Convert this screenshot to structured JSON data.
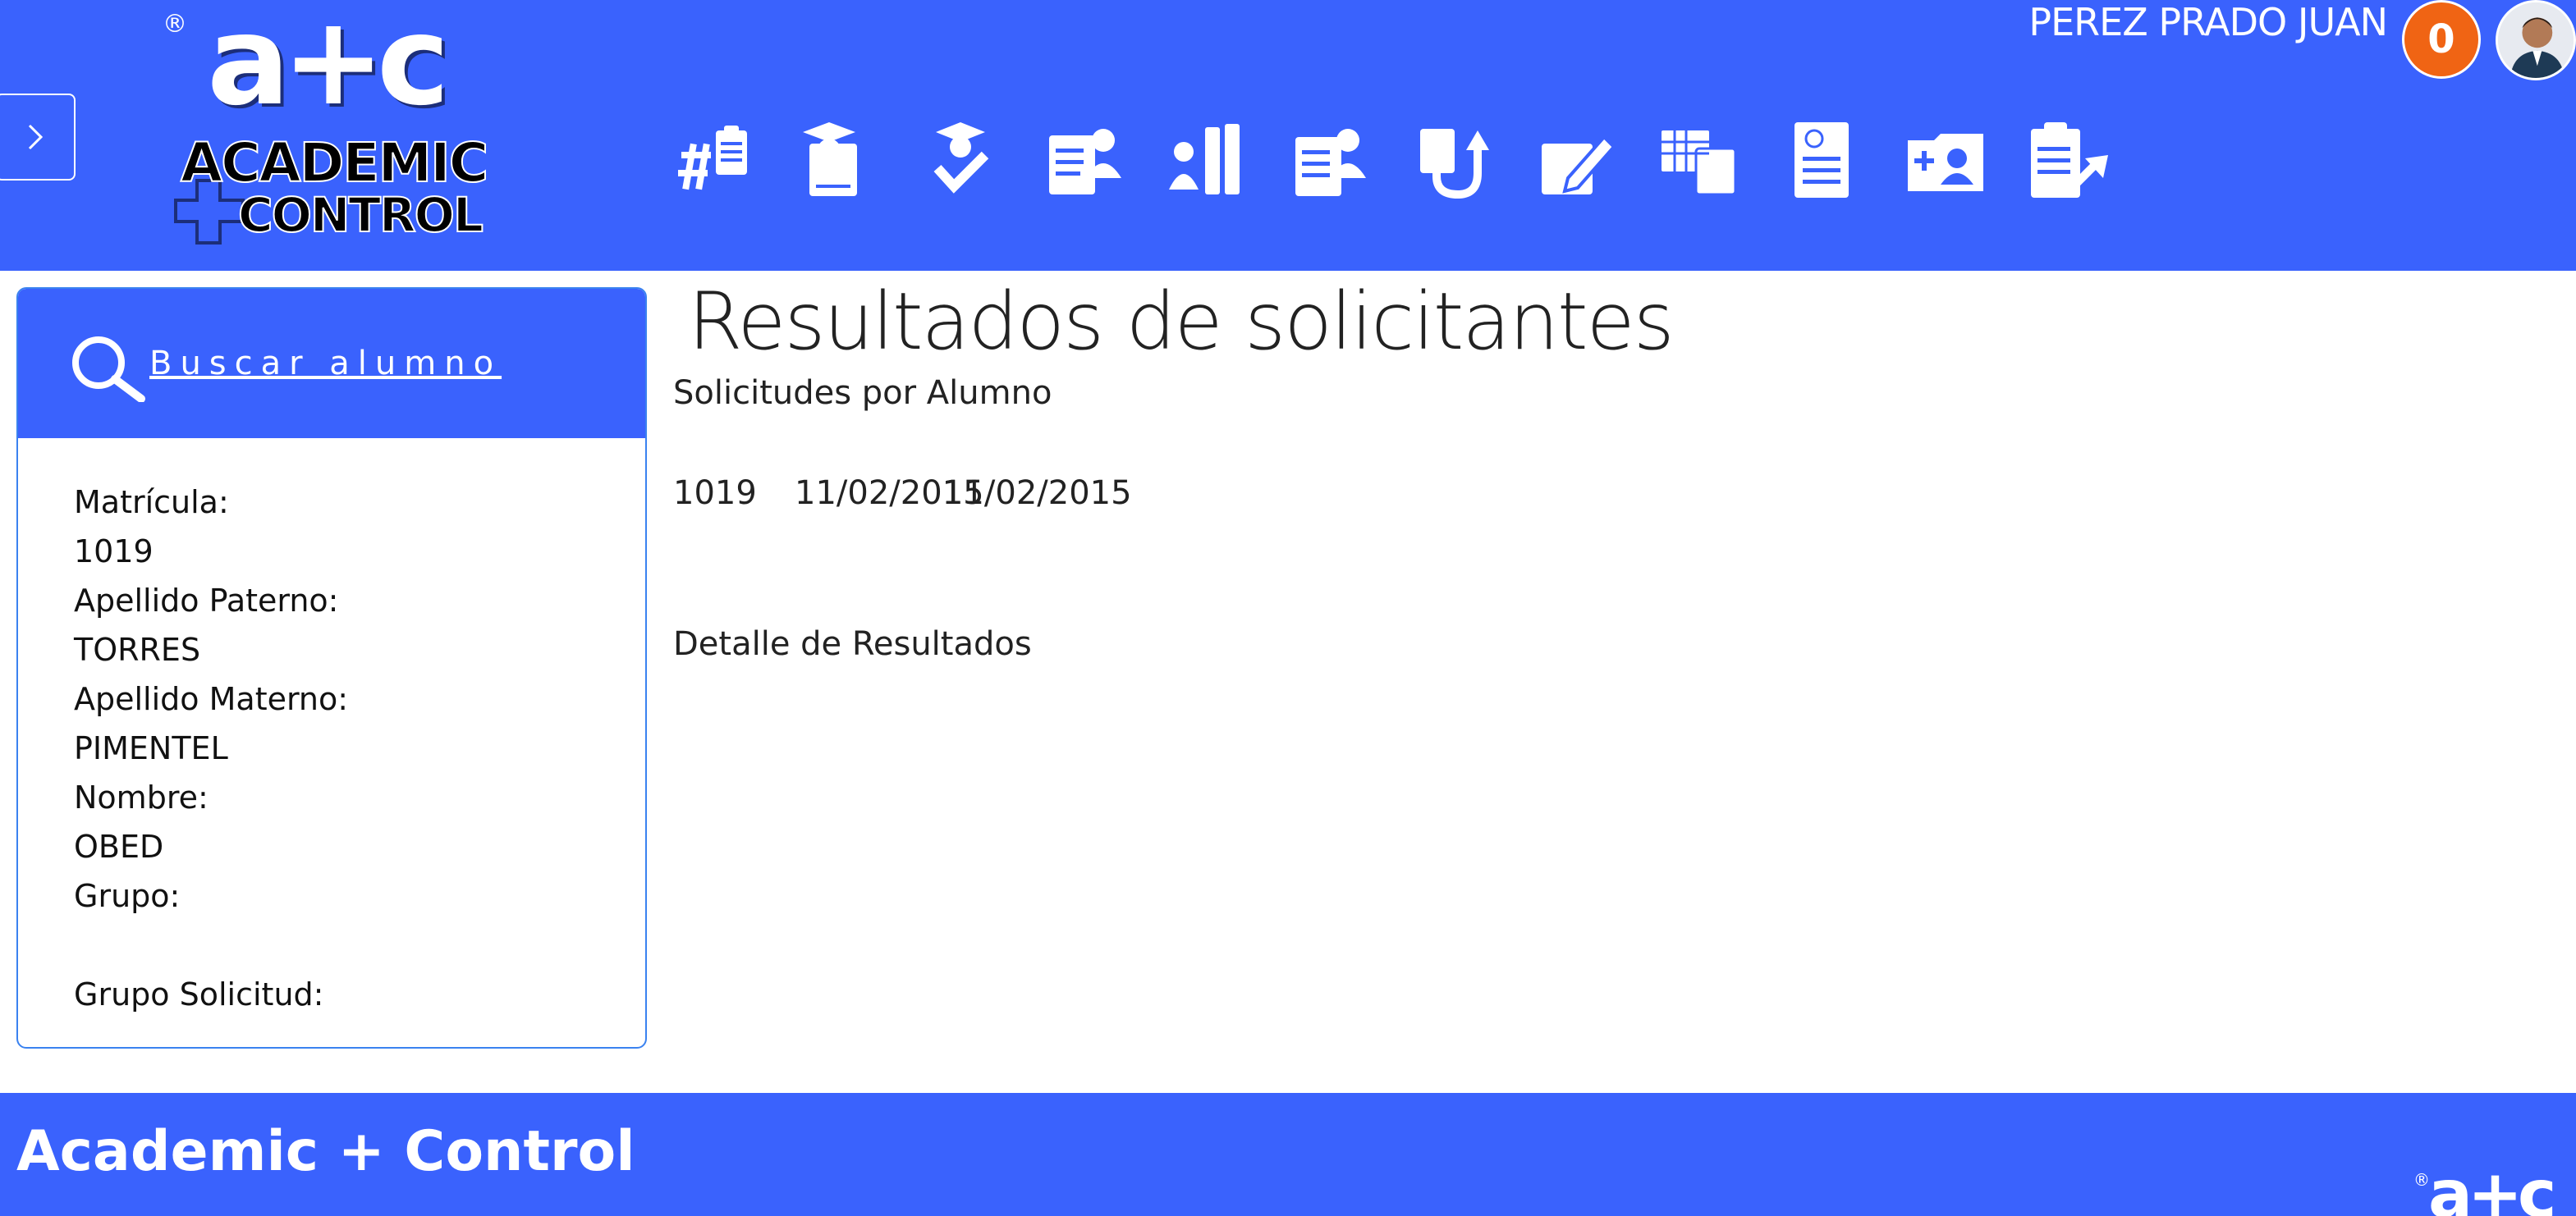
{
  "header": {
    "logo_mark": "a+c",
    "logo_line1": "ACADEMIC",
    "logo_line2": "CONTROL",
    "user_name": "PEREZ PRADO JUAN",
    "notification_count": "0",
    "nav_icons": [
      "hashtag-list-icon",
      "graduate-document-icon",
      "graduate-check-icon",
      "documents-user-icon",
      "user-binders-icon",
      "user-report-icon",
      "document-return-icon",
      "edit-pencil-icon",
      "table-document-icon",
      "grade-document-icon",
      "add-user-folder-icon",
      "clipboard-arrow-icon"
    ]
  },
  "search_panel": {
    "link_label": "Buscar alumno",
    "fields": [
      {
        "label": "Matrícula:",
        "value": "1019"
      },
      {
        "label": "Apellido Paterno:",
        "value": "TORRES"
      },
      {
        "label": "Apellido Materno:",
        "value": "PIMENTEL"
      },
      {
        "label": "Nombre:",
        "value": "OBED"
      },
      {
        "label": "Grupo:",
        "value": ""
      },
      {
        "label": "Grupo Solicitud:",
        "value": ""
      }
    ]
  },
  "main": {
    "title": "Resultados de solicitantes",
    "sub_heading": "Solicitudes por Alumno",
    "request_row": {
      "id": "1019",
      "date1": "11/02/2015",
      "date2": "11/02/2015"
    },
    "detail_heading": "Detalle de Resultados"
  },
  "footer": {
    "title": "Academic + Control",
    "logo_mark": "a+c"
  },
  "colors": {
    "brand_blue": "#3a62fd",
    "badge_orange": "#f06414",
    "panel_border": "#3a82f0"
  }
}
